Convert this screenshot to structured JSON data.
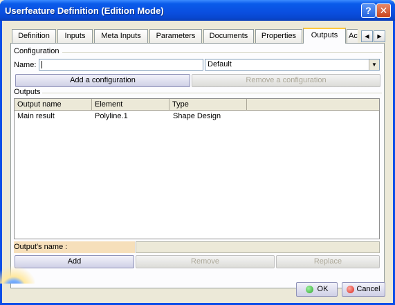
{
  "window": {
    "title": "Userfeature Definition (Edition Mode)",
    "help_label": "?",
    "close_label": "✕"
  },
  "tabs": [
    {
      "label": "Definition"
    },
    {
      "label": "Inputs"
    },
    {
      "label": "Meta Inputs"
    },
    {
      "label": "Parameters"
    },
    {
      "label": "Documents"
    },
    {
      "label": "Properties"
    },
    {
      "label": "Outputs"
    },
    {
      "label": "Ac"
    }
  ],
  "active_tab": "Outputs",
  "tab_scroll": {
    "left_icon": "◀",
    "right_icon": "▶"
  },
  "configuration": {
    "group_label": "Configuration",
    "name_label": "Name:",
    "name_value": "",
    "combo_value": "Default",
    "combo_arrow": "▼",
    "add_label": "Add a configuration",
    "remove_label": "Remove a configuration"
  },
  "outputs": {
    "group_label": "Outputs",
    "columns": [
      "Output name",
      "Element",
      "Type"
    ],
    "rows": [
      [
        "Main result",
        "Polyline.1",
        "Shape Design"
      ]
    ],
    "name_label": "Output's name :",
    "name_value": "",
    "add_label": "Add",
    "remove_label": "Remove",
    "replace_label": "Replace"
  },
  "footer": {
    "ok_label": "OK",
    "cancel_label": "Cancel",
    "ok_color": "#2fa82f",
    "cancel_color": "#d9261c"
  }
}
